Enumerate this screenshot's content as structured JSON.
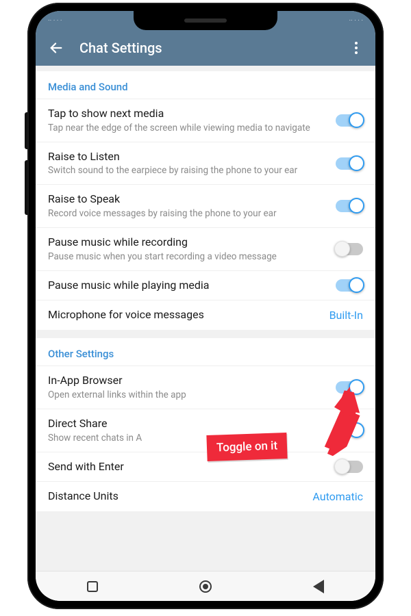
{
  "header": {
    "title": "Chat Settings"
  },
  "section1": {
    "title": "Media and Sound",
    "row0": {
      "title": "Tap to show next media",
      "sub": "Tap near the edge of the screen while viewing media to navigate"
    },
    "row1": {
      "title": "Raise to Listen",
      "sub": "Switch sound to the earpiece by raising the phone to your ear"
    },
    "row2": {
      "title": "Raise to Speak",
      "sub": "Record voice messages by raising the phone to your ear"
    },
    "row3": {
      "title": "Pause music while recording",
      "sub": "Pause music when you start recording a video message"
    },
    "row4": {
      "title": "Pause music while playing media"
    },
    "row5": {
      "title": "Microphone for voice messages",
      "value": "Built-In"
    }
  },
  "section2": {
    "title": "Other Settings",
    "row0": {
      "title": "In-App Browser",
      "sub": "Open external links within the app"
    },
    "row1": {
      "title": "Direct Share",
      "sub": "Show recent chats in A"
    },
    "row2": {
      "title": "Send with Enter"
    },
    "row3": {
      "title": "Distance Units",
      "value": "Automatic"
    }
  },
  "annotation": {
    "label": "Toggle on it"
  }
}
